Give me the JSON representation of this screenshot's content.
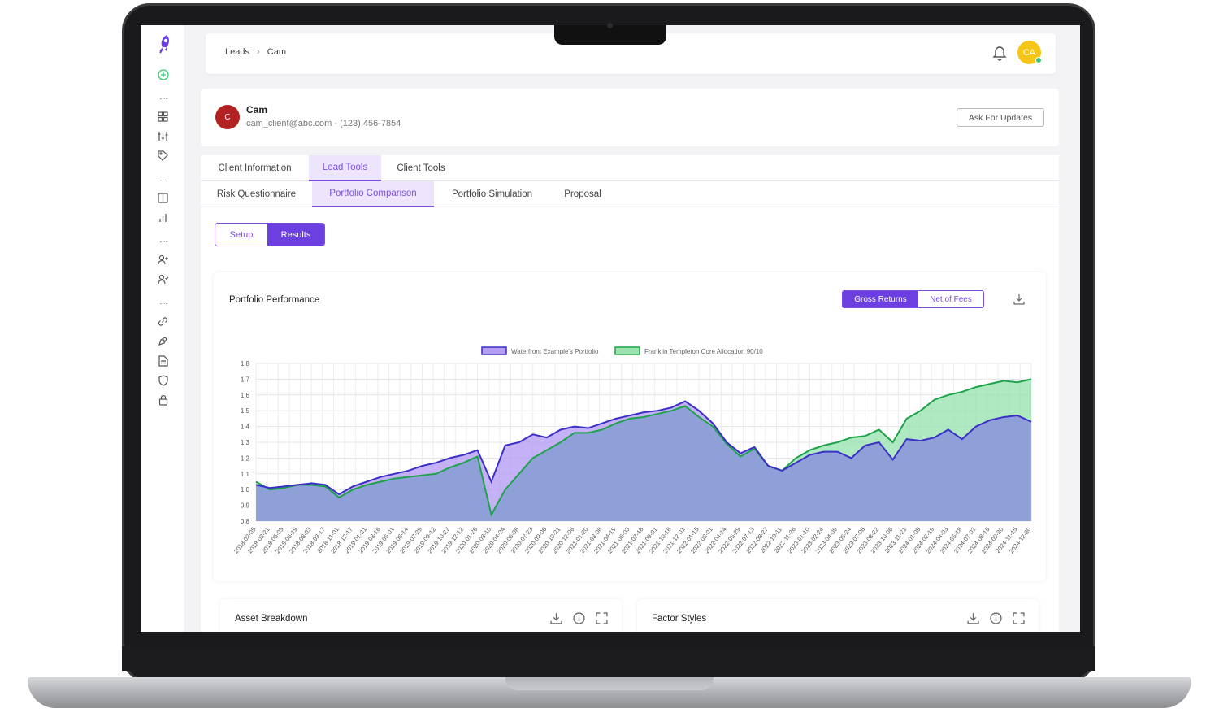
{
  "breadcrumb": {
    "items": [
      "Leads",
      "Cam"
    ],
    "separator": "›"
  },
  "user_avatar": {
    "initials": "CA",
    "color": "#f5c518",
    "status": "online"
  },
  "client": {
    "initial": "C",
    "name": "Cam",
    "meta": "cam_client@abc.com · (123) 456-7854",
    "avatar_color": "#b22222",
    "ask_button": "Ask For Updates"
  },
  "tabs_primary": [
    {
      "label": "Client Information",
      "active": false
    },
    {
      "label": "Lead Tools",
      "active": true
    },
    {
      "label": "Client Tools",
      "active": false
    }
  ],
  "tabs_secondary": [
    {
      "label": "Risk Questionnaire",
      "active": false
    },
    {
      "label": "Portfolio Comparison",
      "active": true
    },
    {
      "label": "Portfolio Simulation",
      "active": false
    },
    {
      "label": "Proposal",
      "active": false
    }
  ],
  "view_toggle": {
    "setup": "Setup",
    "results": "Results",
    "selected": "Results"
  },
  "performance": {
    "title": "Portfolio Performance",
    "gross": "Gross Returns",
    "net": "Net of Fees",
    "selected": "Gross Returns"
  },
  "bottom_cards": {
    "asset": "Asset Breakdown",
    "factor": "Factor Styles"
  },
  "colors": {
    "accent": "#6b3fe0",
    "purple_series": "#3b2fc7",
    "green_series": "#1fa34a"
  },
  "chart_data": {
    "type": "area",
    "title": "",
    "xlabel": "",
    "ylabel": "",
    "ylim": [
      0.8,
      1.8
    ],
    "yticks": [
      0.8,
      0.9,
      1.0,
      1.1,
      1.2,
      1.3,
      1.4,
      1.5,
      1.6,
      1.7,
      1.8
    ],
    "legend_position": "top-center",
    "grid": true,
    "x": [
      "2018-02-05",
      "2018-03-21",
      "2018-05-05",
      "2018-06-19",
      "2018-08-03",
      "2018-09-17",
      "2018-11-01",
      "2018-12-17",
      "2019-01-31",
      "2019-03-16",
      "2019-05-01",
      "2019-06-14",
      "2019-07-29",
      "2019-09-12",
      "2019-10-27",
      "2019-12-12",
      "2020-01-26",
      "2020-03-10",
      "2020-04-24",
      "2020-06-08",
      "2020-07-23",
      "2020-09-06",
      "2020-10-21",
      "2020-12-06",
      "2021-01-20",
      "2021-03-06",
      "2021-04-19",
      "2021-06-03",
      "2021-07-18",
      "2021-09-01",
      "2021-10-16",
      "2021-12-01",
      "2022-01-15",
      "2022-03-01",
      "2022-04-14",
      "2022-05-29",
      "2022-07-13",
      "2022-08-27",
      "2022-10-11",
      "2022-11-26",
      "2023-01-10",
      "2023-02-24",
      "2023-04-09",
      "2023-05-24",
      "2023-07-08",
      "2023-08-22",
      "2023-10-06",
      "2023-11-21",
      "2024-01-05",
      "2024-02-19",
      "2024-04-03",
      "2024-05-18",
      "2024-07-02",
      "2024-08-16",
      "2024-09-30",
      "2024-11-15",
      "2024-12-30"
    ],
    "series": [
      {
        "name": "Waterfront Example's Portfolio",
        "color": "#3b2fc7",
        "fill": "#b79df2",
        "values": [
          1.03,
          1.01,
          1.02,
          1.03,
          1.04,
          1.03,
          0.97,
          1.02,
          1.05,
          1.08,
          1.1,
          1.12,
          1.15,
          1.17,
          1.2,
          1.22,
          1.25,
          1.05,
          1.28,
          1.3,
          1.35,
          1.33,
          1.38,
          1.4,
          1.39,
          1.42,
          1.45,
          1.47,
          1.49,
          1.5,
          1.52,
          1.56,
          1.5,
          1.42,
          1.3,
          1.23,
          1.27,
          1.15,
          1.12,
          1.17,
          1.22,
          1.24,
          1.24,
          1.2,
          1.28,
          1.3,
          1.19,
          1.32,
          1.31,
          1.33,
          1.38,
          1.32,
          1.4,
          1.44,
          1.46,
          1.47,
          1.43
        ]
      },
      {
        "name": "Franklin Templeton Core Allocation 90/10",
        "color": "#1fa34a",
        "fill": "#9be3b1",
        "values": [
          1.05,
          1.0,
          1.01,
          1.03,
          1.03,
          1.02,
          0.95,
          1.0,
          1.03,
          1.05,
          1.07,
          1.08,
          1.09,
          1.1,
          1.14,
          1.17,
          1.21,
          0.84,
          1.0,
          1.1,
          1.2,
          1.25,
          1.3,
          1.36,
          1.36,
          1.38,
          1.42,
          1.45,
          1.46,
          1.48,
          1.5,
          1.53,
          1.46,
          1.4,
          1.29,
          1.21,
          1.26,
          1.15,
          1.12,
          1.2,
          1.25,
          1.28,
          1.3,
          1.33,
          1.34,
          1.38,
          1.3,
          1.45,
          1.5,
          1.57,
          1.6,
          1.62,
          1.65,
          1.67,
          1.69,
          1.68,
          1.7
        ]
      }
    ]
  }
}
